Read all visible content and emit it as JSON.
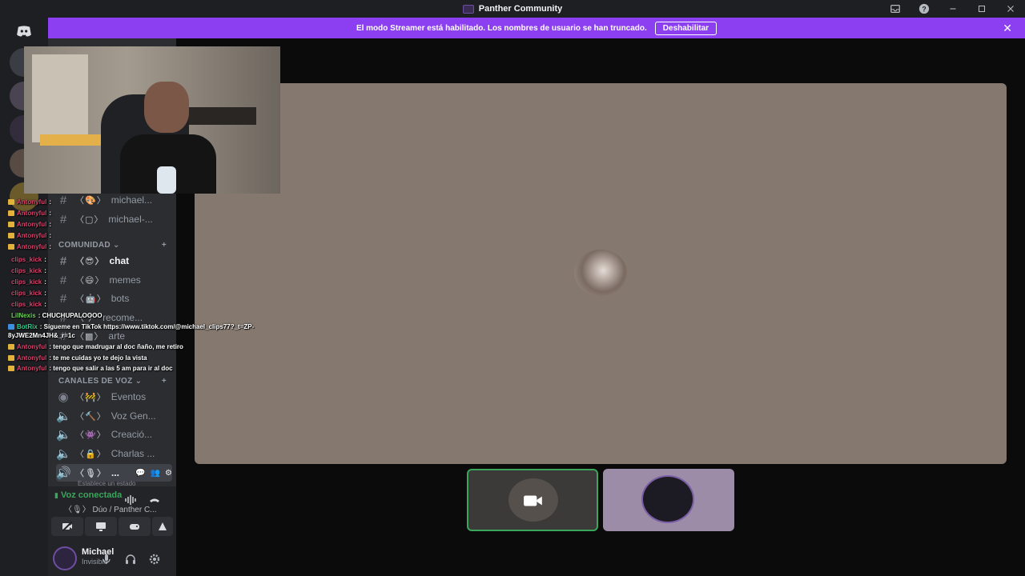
{
  "window": {
    "title": "Panther Community"
  },
  "colors": {
    "accent": "#8b3ff0",
    "connected": "#3ba55c",
    "stage": "#85796f"
  },
  "banner": {
    "text": "El modo Streamer está habilitado. Los nombres de usuario se han truncado.",
    "button_label": "Deshabilitar",
    "close_icon": "close-icon"
  },
  "sidebar": {
    "text_channels_top": [
      {
        "emoji": "〈🎨〉",
        "name": "michael..."
      },
      {
        "emoji": "〈▢〉",
        "name": "michael-..."
      }
    ],
    "category_community": "COMUNIDAD",
    "community_channels": [
      {
        "emoji": "〈😎〉",
        "name": "chat"
      },
      {
        "emoji": "〈😄〉",
        "name": "memes"
      },
      {
        "emoji": "〈🤖〉",
        "name": "bots"
      },
      {
        "emoji": "〈  〉",
        "name": "recome..."
      },
      {
        "emoji": "〈▩〉",
        "name": "arte"
      }
    ],
    "category_voice": "CANALES DE VOZ",
    "voice_channels": [
      {
        "emoji": "〈🚧〉",
        "name": "Eventos"
      },
      {
        "emoji": "〈🔨〉",
        "name": "Voz Gen..."
      },
      {
        "emoji": "〈👾〉",
        "name": "Creació..."
      },
      {
        "emoji": "〈🔒〉",
        "name": "Charlas ..."
      },
      {
        "emoji": "〈🎙〉",
        "name": "..."
      }
    ],
    "voice_status_hint": "Establece un estado"
  },
  "voice": {
    "status": "Voz conectada",
    "channel": "〈🎙〉 Dúo / Panther C..."
  },
  "user": {
    "name": "Michael",
    "status": "Invisible"
  },
  "stream_chat": [
    {
      "user": "Antonyful",
      "msg": ":",
      "badge": "gold"
    },
    {
      "user": "Antonyful",
      "msg": ":",
      "badge": "gold"
    },
    {
      "user": "Antonyful",
      "msg": ":",
      "badge": "gold"
    },
    {
      "user": "Antonyful",
      "msg": ":",
      "badge": "gold"
    },
    {
      "user": "Antonyful",
      "msg": ":",
      "badge": "gold"
    },
    {
      "user": "clips_kick",
      "msg": ":",
      "badge": ""
    },
    {
      "user": "clips_kick",
      "msg": ":",
      "badge": ""
    },
    {
      "user": "clips_kick",
      "msg": ":",
      "badge": ""
    },
    {
      "user": "clips_kick",
      "msg": ":",
      "badge": ""
    },
    {
      "user": "clips_kick",
      "msg": ":",
      "badge": ""
    },
    {
      "user": "LilNexis",
      "msg": ": CHUCHUPALOOOO",
      "badge": ""
    },
    {
      "user": "BotRix",
      "msg": ": Sígueme en TikTok https://www.tiktok.com/@michael_clips77?_t=ZP-",
      "badge": "blue"
    },
    {
      "user": "",
      "msg": "8yJWE2Mn4JH&_r=1c",
      "badge": ""
    },
    {
      "user": "Antonyful",
      "msg": ": tengo que madrugar al doc ñaño, me retiro",
      "badge": "gold"
    },
    {
      "user": "Antonyful",
      "msg": ": te me cuidas yo te dejo la vista",
      "badge": "gold"
    },
    {
      "user": "Antonyful",
      "msg": ": tengo que salir a las 5 am para ir al doc",
      "badge": "gold"
    }
  ]
}
